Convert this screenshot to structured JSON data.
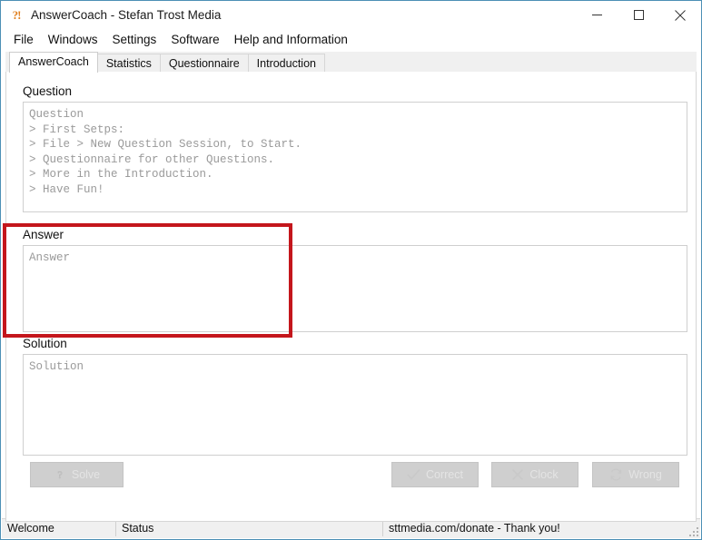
{
  "window": {
    "app_icon": "question-exclamation-icon",
    "title": "AnswerCoach - Stefan Trost Media",
    "controls": {
      "minimize": "minimize-icon",
      "maximize": "maximize-icon",
      "close": "close-icon"
    }
  },
  "menubar": {
    "items": [
      {
        "label": "File"
      },
      {
        "label": "Windows"
      },
      {
        "label": "Settings"
      },
      {
        "label": "Software"
      },
      {
        "label": "Help and Information"
      }
    ]
  },
  "tabs": [
    {
      "label": "AnswerCoach",
      "active": true
    },
    {
      "label": "Statistics",
      "active": false
    },
    {
      "label": "Questionnaire",
      "active": false
    },
    {
      "label": "Introduction",
      "active": false
    }
  ],
  "groups": {
    "question": {
      "title": "Question",
      "text": "Question\n> First Setps:\n> File > New Question Session, to Start.\n> Questionnaire for other Questions.\n> More in the Introduction.\n> Have Fun!"
    },
    "answer": {
      "title": "Answer",
      "text": "Answer"
    },
    "solution": {
      "title": "Solution",
      "text": "Solution"
    }
  },
  "buttons": {
    "solve": {
      "label": "Solve",
      "icon": "question-mark-icon",
      "disabled": true
    },
    "correct": {
      "label": "Correct",
      "icon": "check-mark-icon",
      "disabled": true
    },
    "clock": {
      "label": "Clock",
      "icon": "cross-x-icon",
      "disabled": true
    },
    "wrong": {
      "label": "Wrong",
      "icon": "refresh-cycle-icon",
      "disabled": true
    }
  },
  "statusbar": {
    "welcome": "Welcome",
    "status": "Status",
    "donate": "sttmedia.com/donate - Thank you!"
  },
  "annotation": {
    "name": "answer-section-highlight",
    "color": "#c4161c"
  },
  "colors": {
    "window_border": "#4c8fb5",
    "tab_background": "#f0f0f0",
    "field_border": "#cfcfcf",
    "placeholder_text": "#9a9a9a",
    "button_face": "#cfcfcf",
    "button_text_disabled": "#e4e4e4",
    "accent_icon": "#e08020",
    "highlight": "#c4161c"
  }
}
